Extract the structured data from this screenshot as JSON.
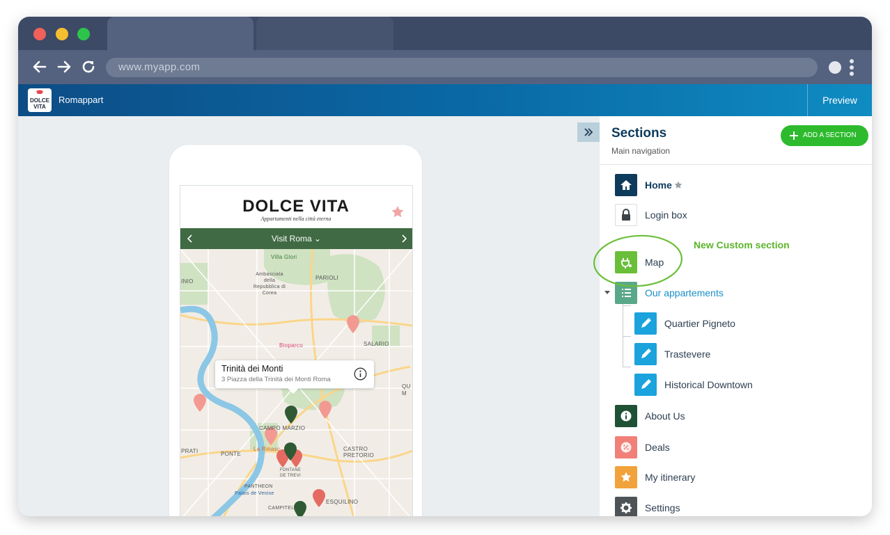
{
  "browser": {
    "url": "www.myapp.com",
    "colors": {
      "close": "#f2605a",
      "minimize": "#f6bf30",
      "maximize": "#2dc44b"
    }
  },
  "app": {
    "name": "Romappart",
    "logo_text_top": "DOLCE",
    "logo_text_bottom": "VITA",
    "preview_label": "Preview"
  },
  "phone": {
    "brand_title": "DOLCE VITA",
    "brand_subtitle": "Appartamenti nella città eterna",
    "nav_title": "Visit Roma",
    "callout_title": "Trinità dei Monti",
    "callout_address": "3 Piazza della Trinità dei Monti Roma",
    "map_labels": [
      "Villa Glori",
      "Ambasciata della Repubblica di Corea",
      "PARIOLI",
      "INIO",
      "Bioparco",
      "SALARIO",
      "CAMPO MARZIO",
      "La Rinasc",
      "PONTE",
      "CASTRO PRETORIO",
      "FONTANE DE TREVI",
      "PANTHEON",
      "Palais de Venise",
      "ESQUILINO",
      "CAMPITEL",
      "PRATI",
      "QU M"
    ]
  },
  "sections": {
    "title": "Sections",
    "subtitle": "Main navigation",
    "add_button": "ADD A SECTION",
    "annotation": "New Custom section",
    "items": [
      {
        "label": "Home",
        "icon": "home-icon",
        "color": "#0e3a5c"
      },
      {
        "label": "Login box",
        "icon": "lock-icon",
        "color": "#ffffff"
      },
      {
        "label": "Map",
        "icon": "map-pin-icon",
        "color": "#6abf3a"
      },
      {
        "label": "Our appartements",
        "icon": "list-icon",
        "color": "#5aa88a"
      },
      {
        "label": "Quartier Pigneto",
        "icon": "pencil-icon",
        "color": "#1aa3dc"
      },
      {
        "label": "Trastevere",
        "icon": "pencil-icon",
        "color": "#1aa3dc"
      },
      {
        "label": "Historical Downtown",
        "icon": "pencil-icon",
        "color": "#1aa3dc"
      },
      {
        "label": "About Us",
        "icon": "info-icon",
        "color": "#1f5235"
      },
      {
        "label": "Deals",
        "icon": "percent-badge-icon",
        "color": "#f08078"
      },
      {
        "label": "My itinerary",
        "icon": "star-icon",
        "color": "#f2a23a"
      },
      {
        "label": "Settings",
        "icon": "gear-icon",
        "color": "#4e5357"
      }
    ]
  }
}
